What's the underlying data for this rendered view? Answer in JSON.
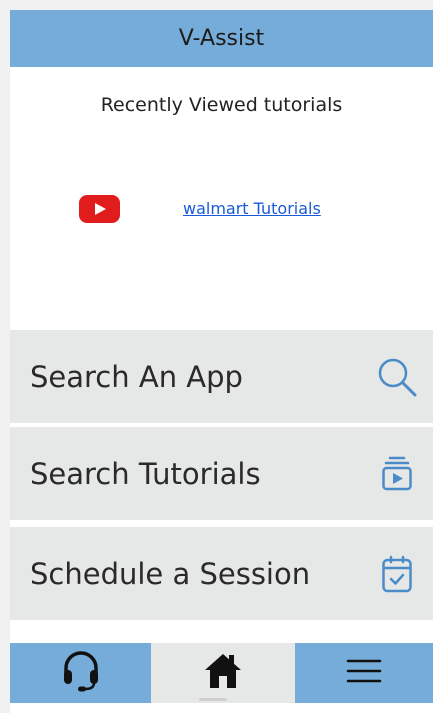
{
  "app": {
    "title": "V-Assist"
  },
  "recent": {
    "title": "Recently Viewed tutorials",
    "items": [
      {
        "icon": "youtube-icon",
        "label": "walmart Tutorials"
      }
    ]
  },
  "menu": {
    "items": [
      {
        "label": "Search An App",
        "icon": "search-icon"
      },
      {
        "label": "Search Tutorials",
        "icon": "video-library-icon"
      },
      {
        "label": "Schedule a Session",
        "icon": "calendar-check-icon"
      }
    ]
  },
  "bottom_nav": {
    "items": [
      {
        "icon": "headset-icon"
      },
      {
        "icon": "home-icon"
      },
      {
        "icon": "hamburger-menu-icon"
      }
    ]
  },
  "colors": {
    "header": "#76acd9",
    "menu_bg": "#e6e8e7",
    "icon_blue": "#4a8cc8",
    "link": "#1a5ad8",
    "youtube_red": "#e01c1c"
  }
}
